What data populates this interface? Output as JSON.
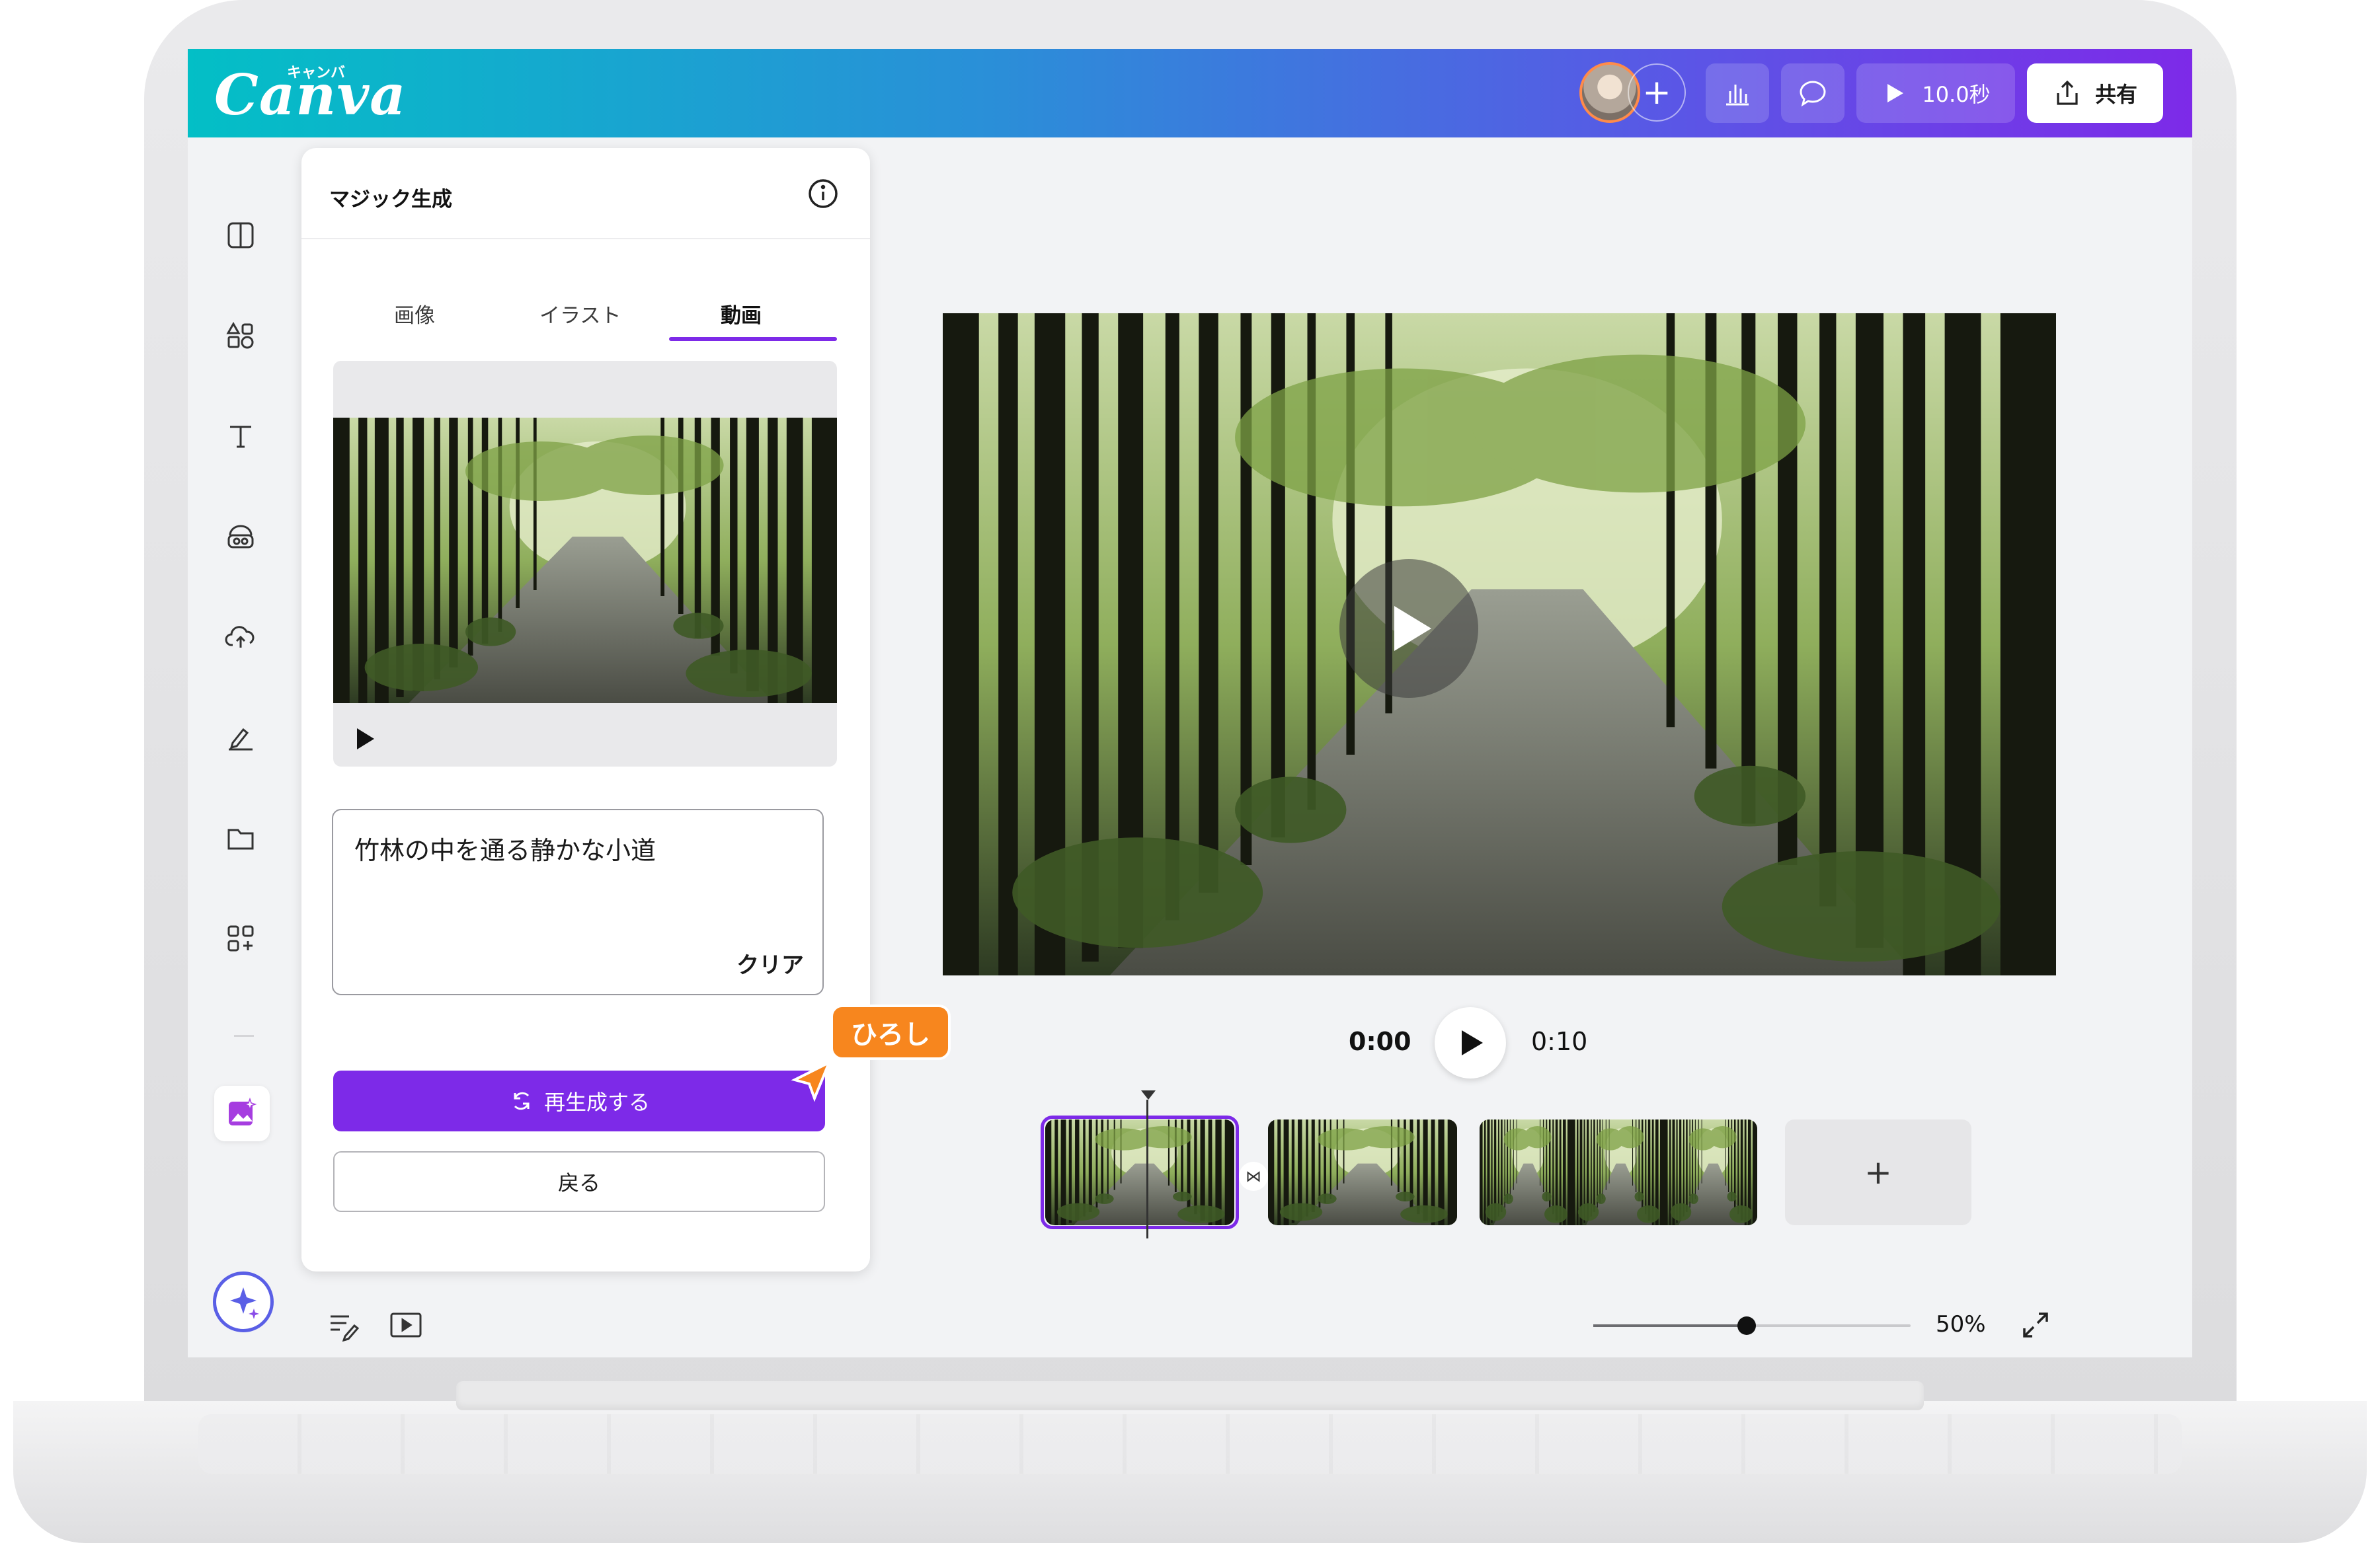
{
  "app": {
    "logo_text": "Canva",
    "logo_kana": "キャンバ"
  },
  "header": {
    "duration_label": "10.0秒",
    "share_label": "共有"
  },
  "panel": {
    "title": "マジック生成",
    "tabs": [
      {
        "label": "画像",
        "active": false
      },
      {
        "label": "イラスト",
        "active": false
      },
      {
        "label": "動画",
        "active": true
      }
    ],
    "prompt_text": "竹林の中を通る静かな小道",
    "clear_label": "クリア",
    "regenerate_label": "再生成する",
    "back_label": "戻る"
  },
  "collaborator": {
    "name": "ひろし"
  },
  "player": {
    "current_time": "0:00",
    "total_time": "0:10"
  },
  "timeline": {
    "add_clip_symbol": "+"
  },
  "zoom": {
    "value": "50%",
    "level": 0.5
  },
  "colors": {
    "accent": "#7d2ae8",
    "header_start": "#03bfc6",
    "header_end": "#7d2ae8",
    "cursor": "#f7861e"
  },
  "icons": {
    "sidebar": [
      "design-icon",
      "elements-icon",
      "text-icon",
      "brand-icon",
      "uploads-icon",
      "draw-icon",
      "projects-icon",
      "apps-icon",
      "magic-media-icon"
    ],
    "header": [
      "avatar",
      "plus-icon",
      "analytics-icon",
      "comment-icon",
      "play-icon",
      "share-icon"
    ],
    "footer": [
      "notes-icon",
      "present-icon",
      "fullscreen-icon",
      "assistant-sparkle-icon"
    ]
  }
}
